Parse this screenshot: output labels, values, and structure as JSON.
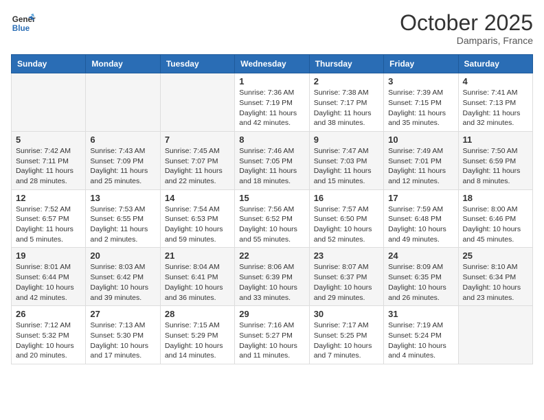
{
  "header": {
    "logo_line1": "General",
    "logo_line2": "Blue",
    "month": "October 2025",
    "location": "Damparis, France"
  },
  "weekdays": [
    "Sunday",
    "Monday",
    "Tuesday",
    "Wednesday",
    "Thursday",
    "Friday",
    "Saturday"
  ],
  "weeks": [
    [
      {
        "day": "",
        "info": ""
      },
      {
        "day": "",
        "info": ""
      },
      {
        "day": "",
        "info": ""
      },
      {
        "day": "1",
        "info": "Sunrise: 7:36 AM\nSunset: 7:19 PM\nDaylight: 11 hours\nand 42 minutes."
      },
      {
        "day": "2",
        "info": "Sunrise: 7:38 AM\nSunset: 7:17 PM\nDaylight: 11 hours\nand 38 minutes."
      },
      {
        "day": "3",
        "info": "Sunrise: 7:39 AM\nSunset: 7:15 PM\nDaylight: 11 hours\nand 35 minutes."
      },
      {
        "day": "4",
        "info": "Sunrise: 7:41 AM\nSunset: 7:13 PM\nDaylight: 11 hours\nand 32 minutes."
      }
    ],
    [
      {
        "day": "5",
        "info": "Sunrise: 7:42 AM\nSunset: 7:11 PM\nDaylight: 11 hours\nand 28 minutes."
      },
      {
        "day": "6",
        "info": "Sunrise: 7:43 AM\nSunset: 7:09 PM\nDaylight: 11 hours\nand 25 minutes."
      },
      {
        "day": "7",
        "info": "Sunrise: 7:45 AM\nSunset: 7:07 PM\nDaylight: 11 hours\nand 22 minutes."
      },
      {
        "day": "8",
        "info": "Sunrise: 7:46 AM\nSunset: 7:05 PM\nDaylight: 11 hours\nand 18 minutes."
      },
      {
        "day": "9",
        "info": "Sunrise: 7:47 AM\nSunset: 7:03 PM\nDaylight: 11 hours\nand 15 minutes."
      },
      {
        "day": "10",
        "info": "Sunrise: 7:49 AM\nSunset: 7:01 PM\nDaylight: 11 hours\nand 12 minutes."
      },
      {
        "day": "11",
        "info": "Sunrise: 7:50 AM\nSunset: 6:59 PM\nDaylight: 11 hours\nand 8 minutes."
      }
    ],
    [
      {
        "day": "12",
        "info": "Sunrise: 7:52 AM\nSunset: 6:57 PM\nDaylight: 11 hours\nand 5 minutes."
      },
      {
        "day": "13",
        "info": "Sunrise: 7:53 AM\nSunset: 6:55 PM\nDaylight: 11 hours\nand 2 minutes."
      },
      {
        "day": "14",
        "info": "Sunrise: 7:54 AM\nSunset: 6:53 PM\nDaylight: 10 hours\nand 59 minutes."
      },
      {
        "day": "15",
        "info": "Sunrise: 7:56 AM\nSunset: 6:52 PM\nDaylight: 10 hours\nand 55 minutes."
      },
      {
        "day": "16",
        "info": "Sunrise: 7:57 AM\nSunset: 6:50 PM\nDaylight: 10 hours\nand 52 minutes."
      },
      {
        "day": "17",
        "info": "Sunrise: 7:59 AM\nSunset: 6:48 PM\nDaylight: 10 hours\nand 49 minutes."
      },
      {
        "day": "18",
        "info": "Sunrise: 8:00 AM\nSunset: 6:46 PM\nDaylight: 10 hours\nand 45 minutes."
      }
    ],
    [
      {
        "day": "19",
        "info": "Sunrise: 8:01 AM\nSunset: 6:44 PM\nDaylight: 10 hours\nand 42 minutes."
      },
      {
        "day": "20",
        "info": "Sunrise: 8:03 AM\nSunset: 6:42 PM\nDaylight: 10 hours\nand 39 minutes."
      },
      {
        "day": "21",
        "info": "Sunrise: 8:04 AM\nSunset: 6:41 PM\nDaylight: 10 hours\nand 36 minutes."
      },
      {
        "day": "22",
        "info": "Sunrise: 8:06 AM\nSunset: 6:39 PM\nDaylight: 10 hours\nand 33 minutes."
      },
      {
        "day": "23",
        "info": "Sunrise: 8:07 AM\nSunset: 6:37 PM\nDaylight: 10 hours\nand 29 minutes."
      },
      {
        "day": "24",
        "info": "Sunrise: 8:09 AM\nSunset: 6:35 PM\nDaylight: 10 hours\nand 26 minutes."
      },
      {
        "day": "25",
        "info": "Sunrise: 8:10 AM\nSunset: 6:34 PM\nDaylight: 10 hours\nand 23 minutes."
      }
    ],
    [
      {
        "day": "26",
        "info": "Sunrise: 7:12 AM\nSunset: 5:32 PM\nDaylight: 10 hours\nand 20 minutes."
      },
      {
        "day": "27",
        "info": "Sunrise: 7:13 AM\nSunset: 5:30 PM\nDaylight: 10 hours\nand 17 minutes."
      },
      {
        "day": "28",
        "info": "Sunrise: 7:15 AM\nSunset: 5:29 PM\nDaylight: 10 hours\nand 14 minutes."
      },
      {
        "day": "29",
        "info": "Sunrise: 7:16 AM\nSunset: 5:27 PM\nDaylight: 10 hours\nand 11 minutes."
      },
      {
        "day": "30",
        "info": "Sunrise: 7:17 AM\nSunset: 5:25 PM\nDaylight: 10 hours\nand 7 minutes."
      },
      {
        "day": "31",
        "info": "Sunrise: 7:19 AM\nSunset: 5:24 PM\nDaylight: 10 hours\nand 4 minutes."
      },
      {
        "day": "",
        "info": ""
      }
    ]
  ]
}
